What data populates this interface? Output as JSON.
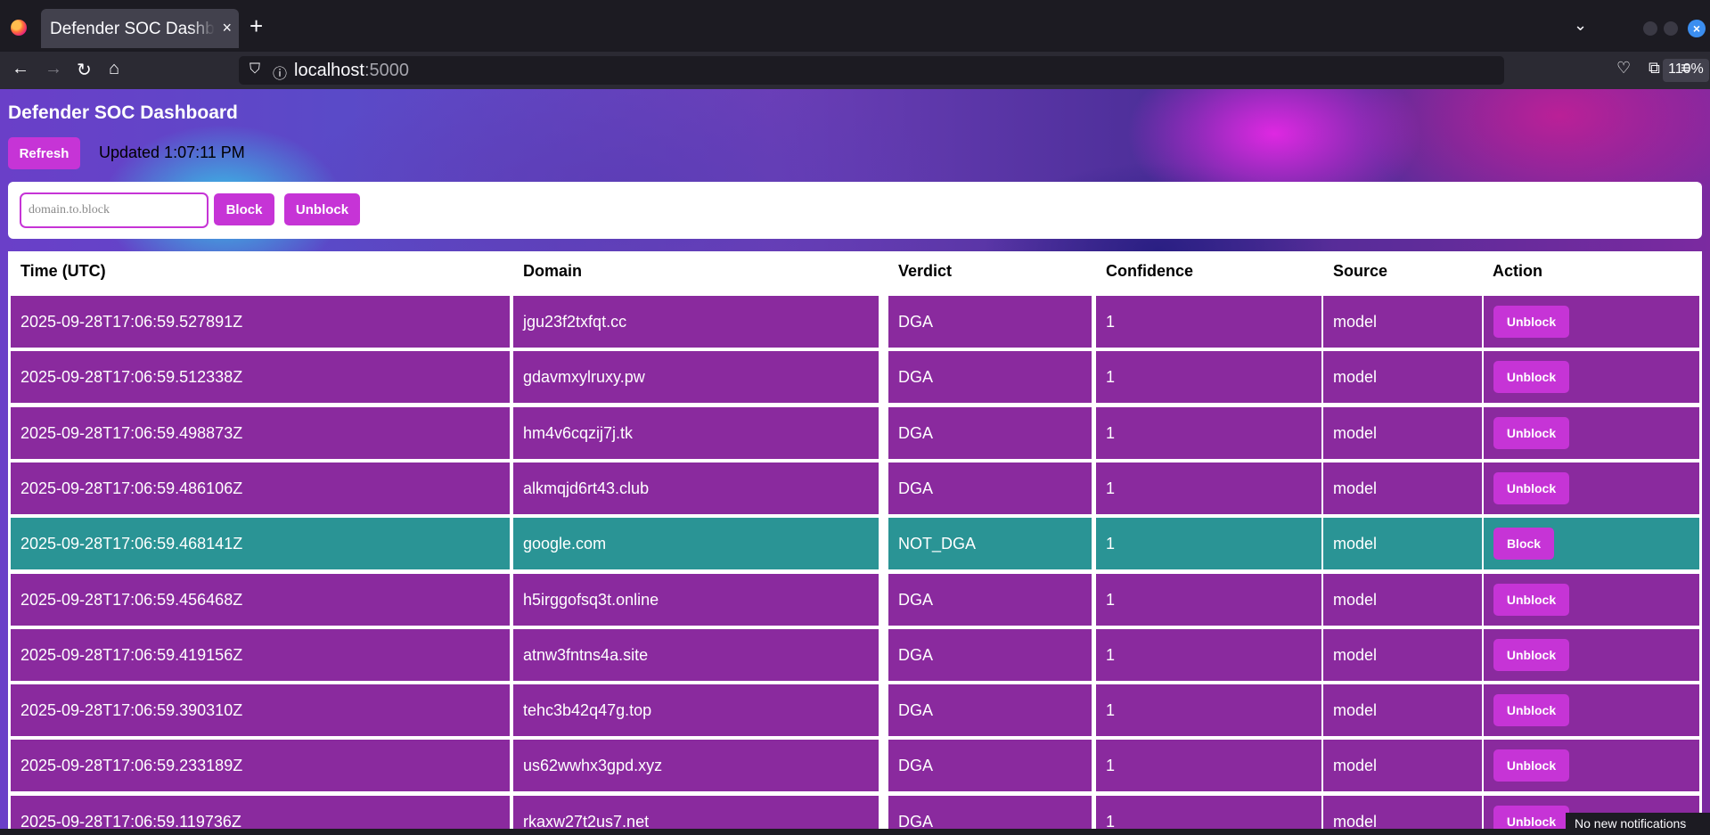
{
  "browser": {
    "tab_title": "Defender SOC Dashboard",
    "tab_close": "×",
    "new_tab": "+",
    "url_host": "localhost",
    "url_port": ":5000",
    "zoom": "110%"
  },
  "page": {
    "title": "Defender SOC Dashboard",
    "refresh_label": "Refresh",
    "updated_text": "Updated 1:07:11 PM",
    "block_placeholder": "domain.to.block",
    "block_label": "Block",
    "unblock_label": "Unblock"
  },
  "table": {
    "headers": [
      "Time (UTC)",
      "Domain",
      "Verdict",
      "Confidence",
      "Source",
      "Action"
    ],
    "rows": [
      {
        "time": "2025-09-28T17:06:59.527891Z",
        "domain": "jgu23f2txfqt.cc",
        "verdict": "DGA",
        "confidence": "1",
        "source": "model",
        "action": "Unblock"
      },
      {
        "time": "2025-09-28T17:06:59.512338Z",
        "domain": "gdavmxylruxy.pw",
        "verdict": "DGA",
        "confidence": "1",
        "source": "model",
        "action": "Unblock"
      },
      {
        "time": "2025-09-28T17:06:59.498873Z",
        "domain": "hm4v6cqzij7j.tk",
        "verdict": "DGA",
        "confidence": "1",
        "source": "model",
        "action": "Unblock"
      },
      {
        "time": "2025-09-28T17:06:59.486106Z",
        "domain": "alkmqjd6rt43.club",
        "verdict": "DGA",
        "confidence": "1",
        "source": "model",
        "action": "Unblock"
      },
      {
        "time": "2025-09-28T17:06:59.468141Z",
        "domain": "google.com",
        "verdict": "NOT_DGA",
        "confidence": "1",
        "source": "model",
        "action": "Block"
      },
      {
        "time": "2025-09-28T17:06:59.456468Z",
        "domain": "h5irggofsq3t.online",
        "verdict": "DGA",
        "confidence": "1",
        "source": "model",
        "action": "Unblock"
      },
      {
        "time": "2025-09-28T17:06:59.419156Z",
        "domain": "atnw3fntns4a.site",
        "verdict": "DGA",
        "confidence": "1",
        "source": "model",
        "action": "Unblock"
      },
      {
        "time": "2025-09-28T17:06:59.390310Z",
        "domain": "tehc3b42q47g.top",
        "verdict": "DGA",
        "confidence": "1",
        "source": "model",
        "action": "Unblock"
      },
      {
        "time": "2025-09-28T17:06:59.233189Z",
        "domain": "us62wwhx3gpd.xyz",
        "verdict": "DGA",
        "confidence": "1",
        "source": "model",
        "action": "Unblock"
      },
      {
        "time": "2025-09-28T17:06:59.119736Z",
        "domain": "rkaxw27t2us7.net",
        "verdict": "DGA",
        "confidence": "1",
        "source": "model",
        "action": "Unblock"
      }
    ]
  },
  "colors": {
    "dga_row": "#8a2a9e",
    "not_dga_row": "#2a9495",
    "accent": "#c634d6"
  },
  "notification": "No new notifications"
}
